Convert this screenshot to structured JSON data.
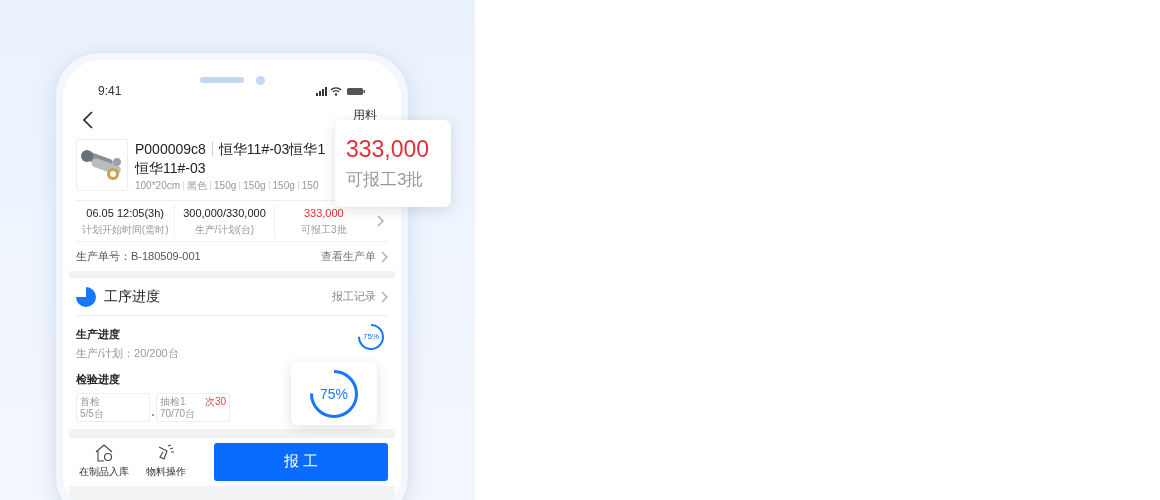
{
  "status_bar": {
    "time": "9:41"
  },
  "nav": {
    "right_action": "用料"
  },
  "product": {
    "code": "P000009c8",
    "name_line1": "恒华11#-03恒华1",
    "name_line2": "恒华11#-03",
    "specs": [
      "100*20cm",
      "黑色",
      "150g",
      "150g",
      "150g",
      "150"
    ]
  },
  "stats": [
    {
      "value": "06.05 12:05(3h)",
      "label": "计划开始时间(需时)",
      "kind": "plain"
    },
    {
      "value": "300,000/330,000",
      "label": "生产/计划(台)",
      "kind": "plain"
    },
    {
      "value": "333,000",
      "label": "可报工3批",
      "kind": "alert"
    }
  ],
  "order": {
    "label": "生产单号：B-180509-001",
    "link": "查看生产单"
  },
  "section": {
    "title": "工序进度",
    "link": "报工记录"
  },
  "production": {
    "title": "生产进度",
    "detail": "生产/计划：20/200台",
    "reading": "75%"
  },
  "inspection": {
    "title": "检验进度",
    "items": [
      {
        "name": "首检",
        "count": "5/5台"
      },
      {
        "name": "抽检1",
        "count": "70/70台",
        "badge": "次30"
      }
    ]
  },
  "bottom": {
    "actions": [
      {
        "label": "在制品入库",
        "kind": "warehouse"
      },
      {
        "label": "物料操作",
        "kind": "material"
      }
    ],
    "primary": "报 工"
  },
  "callouts": {
    "amount": "333,000",
    "amount_note": "可报工3批",
    "progress_reading": "75%"
  }
}
